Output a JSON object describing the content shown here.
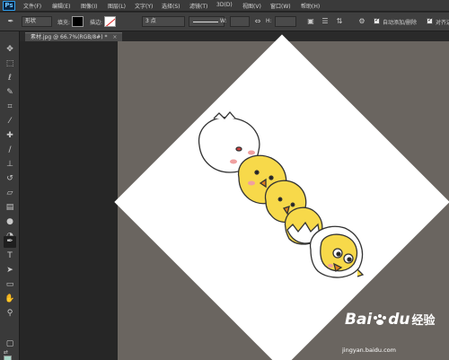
{
  "app": {
    "logo": "Ps"
  },
  "menu": [
    "文件(F)",
    "编辑(E)",
    "图像(I)",
    "图层(L)",
    "文字(Y)",
    "选择(S)",
    "滤镜(T)",
    "3D(D)",
    "视图(V)",
    "窗口(W)",
    "帮助(H)"
  ],
  "options": {
    "mode": "形状",
    "fill_label": "填充:",
    "stroke_label": "描边:",
    "stroke_width": "3 点",
    "w_label": "W:",
    "h_label": "H:",
    "auto_add_delete": "自动添加/删除",
    "align_edges": "对齐边缘",
    "fill_color": "#000000"
  },
  "document": {
    "tab_title": "素材.jpg @ 66.7%(RGB/8#) *",
    "tab_close": "×"
  },
  "toolbar": {
    "tools": [
      "move",
      "marquee",
      "lasso",
      "quick-select",
      "crop",
      "eyedropper",
      "healing",
      "brush",
      "clone-stamp",
      "history-brush",
      "eraser",
      "gradient",
      "blur",
      "dodge",
      "pen",
      "type",
      "path-select",
      "shape",
      "hand",
      "zoom"
    ],
    "foreground_color": "#a8d8c8",
    "background_color": "#ffffff",
    "mode_icon": "▢"
  },
  "watermark": {
    "brand": "Bai",
    "brand2": "du",
    "sub": "经验",
    "url": "jingyan.baidu.com"
  }
}
